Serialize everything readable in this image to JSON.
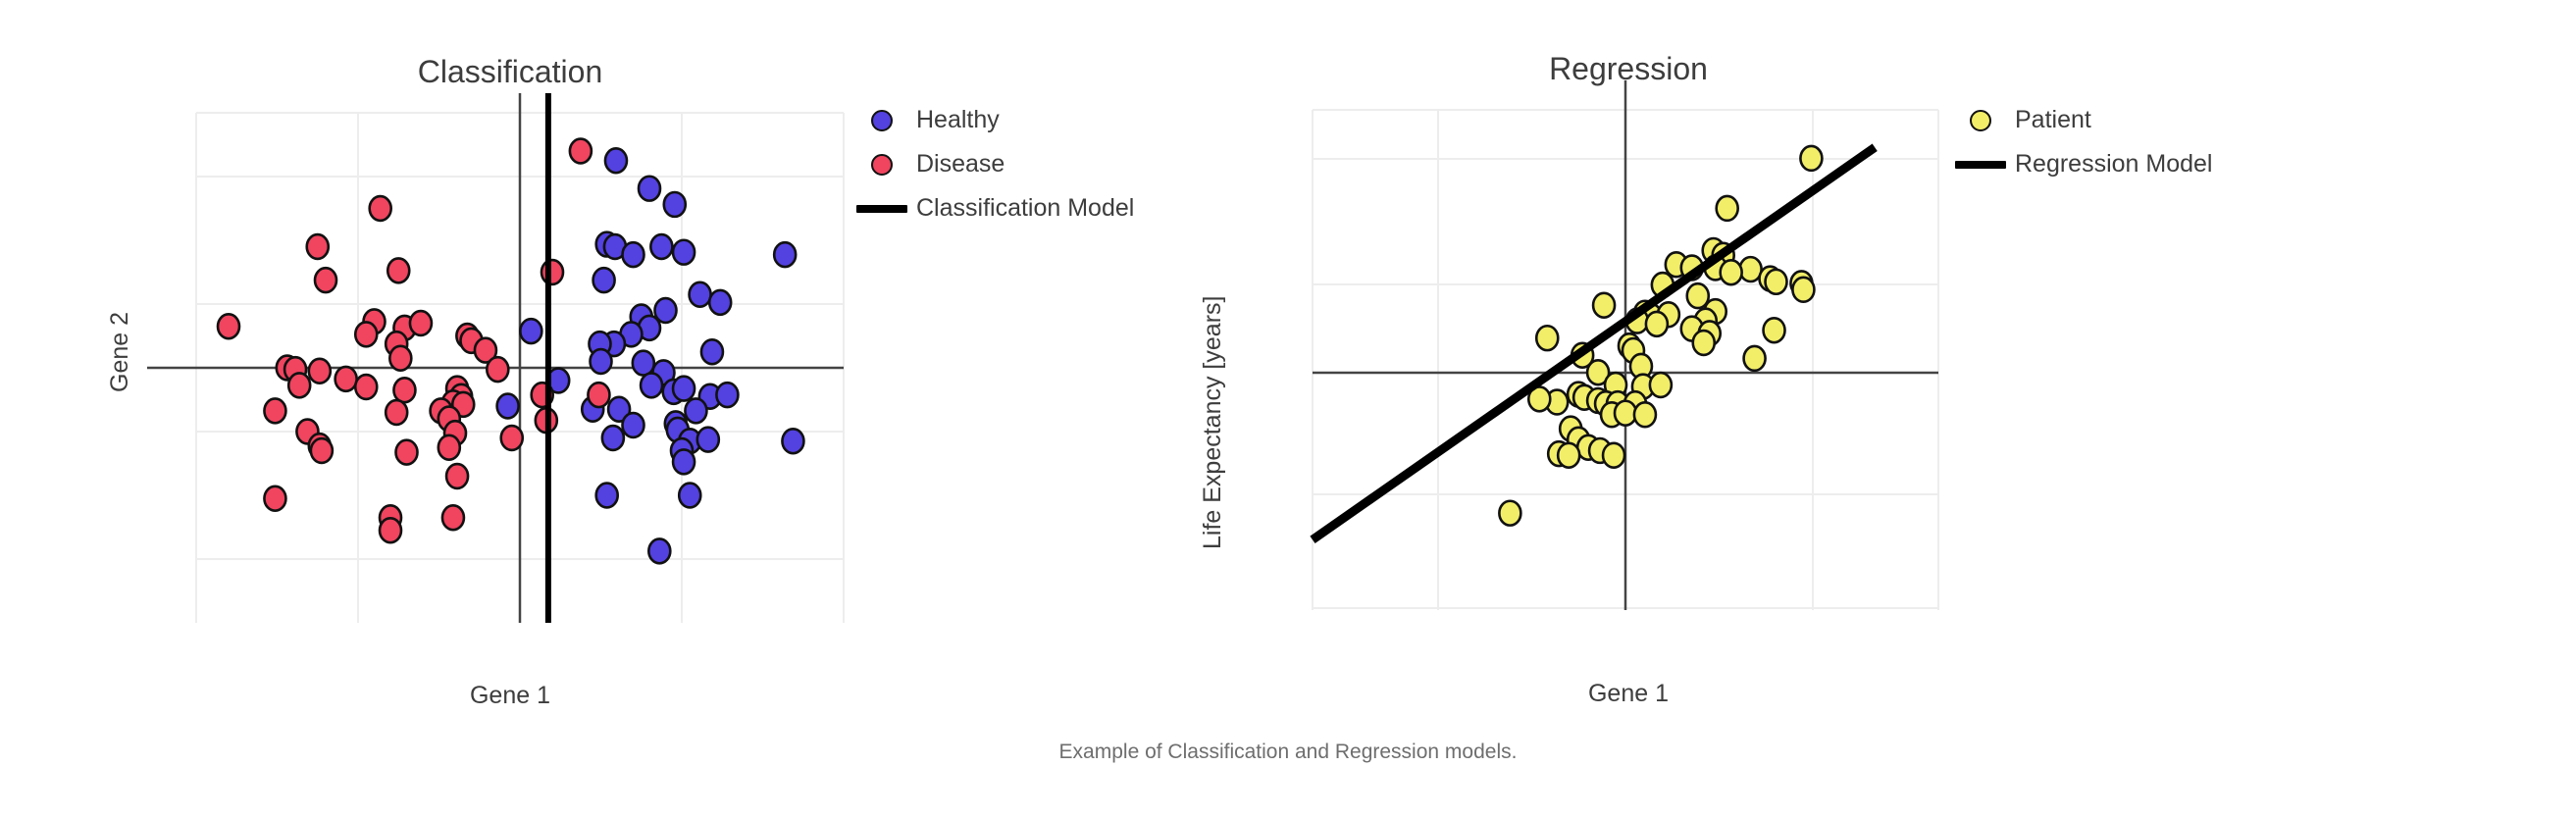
{
  "caption": "Example of Classification and Regression models.",
  "panels": {
    "classification": {
      "title": "Classification",
      "xlabel": "Gene 1",
      "ylabel": "Gene 2",
      "legend": [
        {
          "label": "Healthy",
          "marker": "circle",
          "color": "#5341e0",
          "icon": "circle-marker-icon"
        },
        {
          "label": "Disease",
          "marker": "circle",
          "color": "#f0445f",
          "icon": "circle-marker-icon"
        },
        {
          "label": "Classification Model",
          "marker": "line",
          "color": "#000000",
          "icon": "line-marker-icon"
        }
      ]
    },
    "regression": {
      "title": "Regression",
      "xlabel": "Gene 1",
      "ylabel": "Life Expectancy [years]",
      "legend": [
        {
          "label": "Patient",
          "marker": "circle",
          "color": "#f2ee68",
          "icon": "circle-marker-icon"
        },
        {
          "label": "Regression Model",
          "marker": "line",
          "color": "#000000",
          "icon": "line-marker-icon"
        }
      ]
    }
  },
  "chart_data": [
    {
      "type": "scatter",
      "title": "Classification",
      "xlabel": "Gene 1",
      "ylabel": "Gene 2",
      "xlim": [
        -3.2,
        3.2
      ],
      "ylim": [
        -3.2,
        3.2
      ],
      "grid": true,
      "legend_position": "right",
      "axis_lines": {
        "x_axis_at_y": 0,
        "y_axis_at_x": 0
      },
      "annotations": [
        {
          "name": "classification-boundary",
          "type": "vline",
          "x": 0.28,
          "color": "#000000",
          "width": 6
        }
      ],
      "series": [
        {
          "name": "Healthy",
          "color": "#5341e0",
          "points": [
            [
              0.95,
              2.6
            ],
            [
              1.28,
              2.25
            ],
            [
              1.53,
              2.05
            ],
            [
              0.86,
              1.55
            ],
            [
              0.94,
              1.52
            ],
            [
              1.12,
              1.42
            ],
            [
              1.4,
              1.52
            ],
            [
              1.62,
              1.45
            ],
            [
              2.62,
              1.42
            ],
            [
              0.83,
              1.1
            ],
            [
              1.78,
              0.92
            ],
            [
              1.98,
              0.82
            ],
            [
              1.2,
              0.64
            ],
            [
              1.44,
              0.72
            ],
            [
              1.28,
              0.5
            ],
            [
              1.1,
              0.42
            ],
            [
              0.93,
              0.3
            ],
            [
              0.79,
              0.3
            ],
            [
              0.11,
              0.46
            ],
            [
              0.8,
              0.08
            ],
            [
              1.22,
              0.06
            ],
            [
              1.9,
              0.2
            ],
            [
              1.42,
              -0.06
            ],
            [
              0.38,
              -0.16
            ],
            [
              1.3,
              -0.22
            ],
            [
              1.52,
              -0.3
            ],
            [
              1.62,
              -0.26
            ],
            [
              1.88,
              -0.36
            ],
            [
              2.05,
              -0.34
            ],
            [
              -0.12,
              -0.48
            ],
            [
              0.72,
              -0.52
            ],
            [
              0.98,
              -0.52
            ],
            [
              1.74,
              -0.54
            ],
            [
              1.12,
              -0.72
            ],
            [
              1.54,
              -0.7
            ],
            [
              1.56,
              -0.78
            ],
            [
              0.92,
              -0.88
            ],
            [
              1.68,
              -0.92
            ],
            [
              1.86,
              -0.9
            ],
            [
              2.7,
              -0.92
            ],
            [
              1.6,
              -1.04
            ],
            [
              1.62,
              -1.18
            ],
            [
              0.86,
              -1.6
            ],
            [
              1.68,
              -1.6
            ],
            [
              1.38,
              -2.3
            ]
          ]
        },
        {
          "name": "Disease",
          "color": "#f0445f",
          "points": [
            [
              0.6,
              2.72
            ],
            [
              -1.38,
              2.0
            ],
            [
              -2.0,
              1.52
            ],
            [
              -1.2,
              1.22
            ],
            [
              0.32,
              1.2
            ],
            [
              -1.92,
              1.1
            ],
            [
              -2.88,
              0.52
            ],
            [
              -1.44,
              0.58
            ],
            [
              -1.52,
              0.42
            ],
            [
              -1.14,
              0.5
            ],
            [
              -0.98,
              0.56
            ],
            [
              -1.22,
              0.3
            ],
            [
              -0.52,
              0.4
            ],
            [
              -0.48,
              0.34
            ],
            [
              -0.34,
              0.22
            ],
            [
              -1.18,
              0.12
            ],
            [
              -2.3,
              0.0
            ],
            [
              -2.22,
              -0.02
            ],
            [
              -1.98,
              -0.04
            ],
            [
              -0.22,
              -0.02
            ],
            [
              -1.72,
              -0.14
            ],
            [
              -2.18,
              -0.22
            ],
            [
              -1.52,
              -0.24
            ],
            [
              -1.14,
              -0.28
            ],
            [
              -0.62,
              -0.26
            ],
            [
              -0.58,
              -0.36
            ],
            [
              0.22,
              -0.34
            ],
            [
              0.78,
              -0.34
            ],
            [
              -0.66,
              -0.44
            ],
            [
              -0.56,
              -0.46
            ],
            [
              -2.42,
              -0.54
            ],
            [
              -0.78,
              -0.54
            ],
            [
              -1.22,
              -0.56
            ],
            [
              -0.7,
              -0.64
            ],
            [
              0.26,
              -0.66
            ],
            [
              -2.1,
              -0.8
            ],
            [
              -0.64,
              -0.82
            ],
            [
              -0.08,
              -0.88
            ],
            [
              -1.98,
              -0.98
            ],
            [
              -1.96,
              -1.04
            ],
            [
              -1.12,
              -1.06
            ],
            [
              -0.7,
              -1.0
            ],
            [
              -0.62,
              -1.36
            ],
            [
              -2.42,
              -1.64
            ],
            [
              -1.28,
              -1.88
            ],
            [
              -0.66,
              -1.88
            ],
            [
              -1.28,
              -2.04
            ]
          ]
        }
      ]
    },
    {
      "type": "scatter",
      "title": "Regression",
      "xlabel": "Gene 1",
      "ylabel": "Life Expectancy [years]",
      "xlim": [
        -3.2,
        3.2
      ],
      "ylim": [
        -3.2,
        3.2
      ],
      "grid": true,
      "legend_position": "right",
      "axis_lines": {
        "x_axis_at_y": 0,
        "y_axis_at_x": 0
      },
      "annotations": [
        {
          "name": "regression-line",
          "type": "line",
          "x0": -3.2,
          "y0": -2.3,
          "x1": 2.55,
          "y1": 2.72,
          "color": "#000000",
          "width": 9
        }
      ],
      "series": [
        {
          "name": "Patient",
          "color": "#f2ee68",
          "points": [
            [
              1.9,
              2.58
            ],
            [
              1.04,
              1.94
            ],
            [
              0.9,
              1.4
            ],
            [
              1.0,
              1.34
            ],
            [
              0.52,
              1.22
            ],
            [
              0.68,
              1.18
            ],
            [
              0.92,
              1.18
            ],
            [
              1.28,
              1.16
            ],
            [
              1.08,
              1.12
            ],
            [
              1.48,
              1.04
            ],
            [
              1.54,
              1.0
            ],
            [
              1.8,
              0.98
            ],
            [
              1.82,
              0.9
            ],
            [
              0.38,
              0.96
            ],
            [
              0.74,
              0.82
            ],
            [
              -0.22,
              0.7
            ],
            [
              0.92,
              0.62
            ],
            [
              0.2,
              0.6
            ],
            [
              0.26,
              0.56
            ],
            [
              0.44,
              0.58
            ],
            [
              0.12,
              0.5
            ],
            [
              0.32,
              0.46
            ],
            [
              0.82,
              0.5
            ],
            [
              0.68,
              0.4
            ],
            [
              0.86,
              0.34
            ],
            [
              1.52,
              0.38
            ],
            [
              0.8,
              0.22
            ],
            [
              0.04,
              0.18
            ],
            [
              0.08,
              0.12
            ],
            [
              -0.8,
              0.28
            ],
            [
              -0.44,
              0.06
            ],
            [
              1.32,
              0.02
            ],
            [
              0.16,
              -0.08
            ],
            [
              -0.28,
              -0.16
            ],
            [
              -0.1,
              -0.32
            ],
            [
              0.18,
              -0.34
            ],
            [
              0.36,
              -0.32
            ],
            [
              -0.48,
              -0.44
            ],
            [
              -0.42,
              -0.48
            ],
            [
              -0.7,
              -0.54
            ],
            [
              -0.28,
              -0.52
            ],
            [
              -0.2,
              -0.56
            ],
            [
              -0.08,
              -0.56
            ],
            [
              0.1,
              -0.56
            ],
            [
              -0.88,
              -0.5
            ],
            [
              -0.14,
              -0.7
            ],
            [
              0.0,
              -0.68
            ],
            [
              0.2,
              -0.7
            ],
            [
              -0.56,
              -0.88
            ],
            [
              -0.48,
              -1.02
            ],
            [
              -0.38,
              -1.12
            ],
            [
              -0.26,
              -1.16
            ],
            [
              -0.12,
              -1.22
            ],
            [
              -0.68,
              -1.2
            ],
            [
              -0.58,
              -1.22
            ],
            [
              -1.18,
              -1.96
            ]
          ]
        }
      ]
    }
  ]
}
